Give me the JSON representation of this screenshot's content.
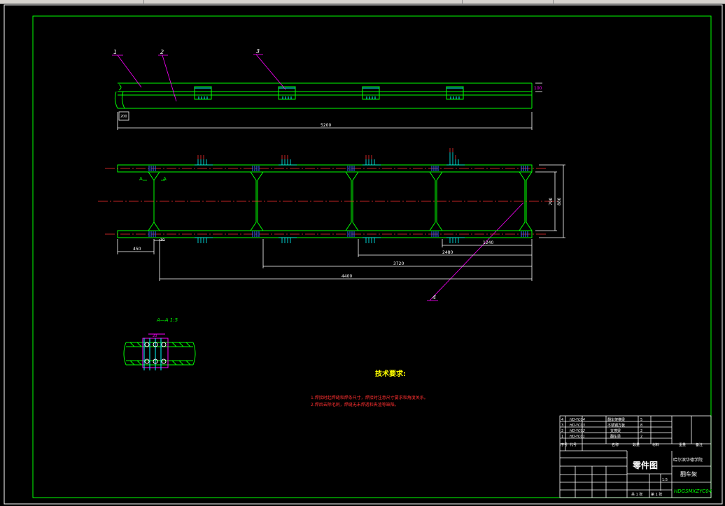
{
  "drawing": {
    "balloons": [
      "1",
      "2",
      "3",
      "4"
    ],
    "dims_top": {
      "height": "100",
      "stub": "200",
      "length": "5200"
    },
    "dims_plan": {
      "left_offset": "450",
      "small": "30",
      "bay": "1240",
      "d2480": "2480",
      "d3720": "3720",
      "d4400": "4400",
      "inner_width": "790",
      "outer_width": "880"
    },
    "section": {
      "label": "A—A  1:5",
      "dim": "20",
      "arrow_label": "A"
    },
    "tech_req": {
      "title": "技术要求:",
      "lines": [
        "1.焊接时起焊缝和焊条尺寸，焊接时注意尺寸要求和角度关系。",
        "2.焊后去除毛刺，焊缝无未焊透和夹渣等缺陷。"
      ]
    }
  },
  "title_block": {
    "parts": [
      {
        "no": "4",
        "code": "HD-YC04",
        "name": "翻车架横梁",
        "qty": "5"
      },
      {
        "no": "3",
        "code": "HD-YC03",
        "name": "不锈钢方板",
        "qty": "8"
      },
      {
        "no": "2",
        "code": "HD-YC02",
        "name": "支撑梁",
        "qty": "2"
      },
      {
        "no": "1",
        "code": "HD-YC01",
        "name": "翻车梁",
        "qty": "2"
      }
    ],
    "header": {
      "no": "序号",
      "code": "代号",
      "name": "名称",
      "qty": "数量",
      "material": "材料",
      "weight": "重量",
      "note": "备注"
    },
    "drawing_kind": "零件图",
    "school": "哈尔滨华德学院",
    "part_name": "翻车架",
    "drawing_no": "HDGSMXZYC04",
    "sheet": {
      "scale": "1:5",
      "total": "共 1 张",
      "page": "第 1 张"
    }
  }
}
